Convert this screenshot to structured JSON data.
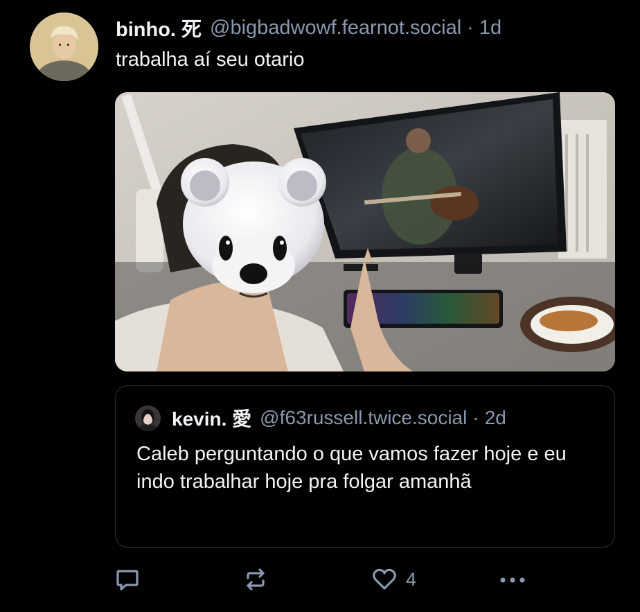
{
  "post": {
    "author": {
      "display_name": "binho. 死",
      "handle": "@bigbadwowf.fearnot.social",
      "avatar_icon": "user-avatar-photo"
    },
    "separator": "·",
    "time": "1d",
    "text": "trabalha aí seu otario",
    "media_icon": "photo-person-with-bear-emoji-at-desk"
  },
  "quote": {
    "author": {
      "display_name": "kevin. 愛",
      "handle": "@f63russell.twice.social",
      "avatar_icon": "user-avatar-photo"
    },
    "separator": "·",
    "time": "2d",
    "text": "Caleb perguntando o que vamos fazer hoje e eu indo trabalhar hoje pra folgar amanhã"
  },
  "actions": {
    "reply_icon": "reply-icon",
    "repost_icon": "repost-icon",
    "like_icon": "heart-icon",
    "like_count": "4",
    "more_icon": "more-icon"
  },
  "colors": {
    "background": "#000000",
    "text_primary": "#f2f4f7",
    "text_secondary": "#8a99ad",
    "quote_border": "#2a3039"
  }
}
